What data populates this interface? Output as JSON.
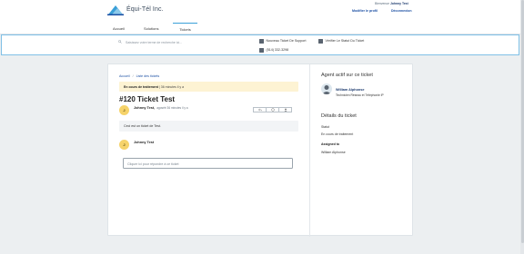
{
  "header": {
    "brand": "Équi-Tél Inc.",
    "welcome_prefix": "Bienvenue",
    "welcome_user": "Johnny Test",
    "links": [
      "Modifier le profil",
      "Déconnexion"
    ]
  },
  "nav": {
    "items": [
      "Accueil",
      "Solutions",
      "Tickets"
    ],
    "active": "Tickets"
  },
  "quickbar": {
    "search_placeholder": "Saisissez votre terme de recherche ici...",
    "new_ticket": "Nouveau Ticket De Support",
    "check_status": "Vérifier Le Statut Du Ticket",
    "phone": "(514) 332-3298"
  },
  "ticket": {
    "breadcrumb": [
      "Accueil",
      "Liste des tickets"
    ],
    "status_label": "En cours de traitement",
    "status_time": "| 36 minutes il y a",
    "title": "#120 Ticket Test",
    "author_initial": "J",
    "author": "Johnny Test,",
    "author_ago": "agoséé 36 minutes il y a",
    "message": "Ceci est un ticket de Test.",
    "reply_author_initial": "J",
    "reply_author": "Johnny Test",
    "reply_placeholder": "Cliquer ici pour répondre à ce ticket"
  },
  "sidebar": {
    "agent_title": "Agent actif sur ce ticket",
    "agent_name": "William Alphonse",
    "agent_role": "Technicien Réseau et Téléphonie IP",
    "details_title": "Détails du ticket",
    "status_label": "Statut",
    "status_value": "En cours de traitement",
    "assigned_label": "Assigned to",
    "assigned_value": "William Alphonse"
  },
  "colors": {
    "accent": "#1b4fa3",
    "status_bg": "#fdf3d3",
    "avatar": "#f6d36a",
    "quickbar_border": "#7fc0e6"
  }
}
